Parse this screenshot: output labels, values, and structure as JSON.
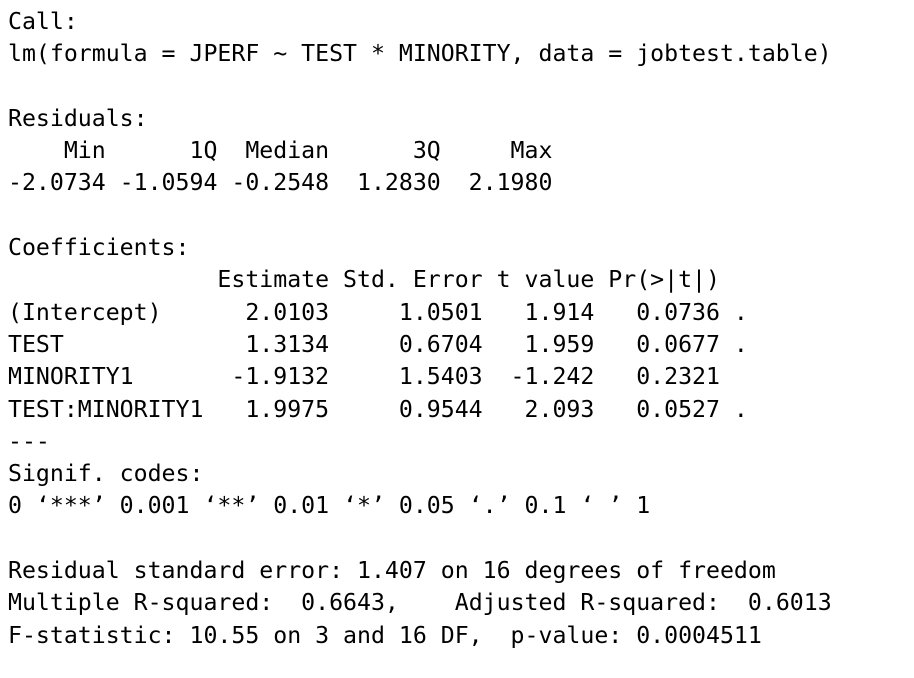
{
  "output": {
    "call_header": "Call:",
    "call_formula": "lm(formula = JPERF ~ TEST * MINORITY, data = jobtest.table)",
    "residuals_header": "Residuals:",
    "residuals_labels": "    Min      1Q  Median      3Q     Max ",
    "residuals_values": "-2.0734 -1.0594 -0.2548  1.2830  2.1980 ",
    "coefficients_header": "Coefficients:",
    "coefficients_columns": "               Estimate Std. Error t value Pr(>|t|)  ",
    "coefficient_rows": [
      "(Intercept)      2.0103     1.0501   1.914   0.0736 .",
      "TEST             1.3134     0.6704   1.959   0.0677 .",
      "MINORITY1       -1.9132     1.5403  -1.242   0.2321  ",
      "TEST:MINORITY1   1.9975     0.9544   2.093   0.0527 ."
    ],
    "separator": "---",
    "signif_header": "Signif. codes:",
    "signif_codes": "0 ‘***’ 0.001 ‘**’ 0.01 ‘*’ 0.05 ‘.’ 0.1 ‘ ’ 1",
    "residual_std_error": "Residual standard error: 1.407 on 16 degrees of freedom",
    "r_squared": "Multiple R-squared:  0.6643,\tAdjusted R-squared:  0.6013 ",
    "f_statistic": "F-statistic: 10.55 on 3 and 16 DF,  p-value: 0.0004511"
  }
}
